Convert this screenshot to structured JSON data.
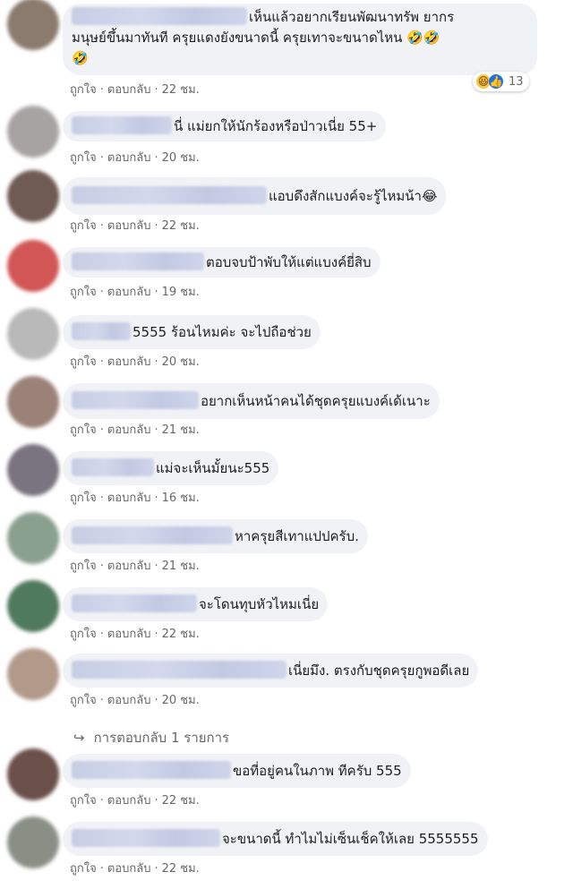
{
  "action_labels": {
    "like": "ถูกใจ",
    "reply": "ตอบกลับ"
  },
  "comments": [
    {
      "text_line1": "เห็นแล้วอยากเรียนพัฒนาทรัพ ยากร",
      "text_line2": "มนุษย์ขึ้นมาทันที ครุยแดงยังขนาดนี้ ครุยเทาจะขนาดไหน 🤣🤣",
      "text_line3": "🤣",
      "time": "22 ชม.",
      "reaction_count": "13",
      "avatar_color": "#8b7b6e"
    },
    {
      "text": "นี่ แม่ยกให้นักร้องหรือป่าวเนี่ย 55+",
      "time": "20 ชม.",
      "avatar_color": "#a7a3a3"
    },
    {
      "text": "แอบดึงสักแบงค์จะรู้ไหมน้า😂",
      "time": "22 ชม.",
      "avatar_color": "#6f5a54"
    },
    {
      "text": "ตอบจบป้าพับให้แต่แบงค์ยี่สิบ",
      "time": "19 ชม.",
      "avatar_color": "#d25656"
    },
    {
      "text": "5555 ร้อนไหมค่ะ จะไปถือช่วย",
      "time": "20 ชม.",
      "avatar_color": "#b9b9b9"
    },
    {
      "text": "อยากเห็นหน้าคนได้ชุดครุยแบงค์เด้เนาะ",
      "time": "21 ชม.",
      "avatar_color": "#9a8278"
    },
    {
      "text": "แม่จะเห็นมั้ยนะ555",
      "time": "16 ชม.",
      "avatar_color": "#7a7380"
    },
    {
      "text": "หาครุยสีเทาแปปครับ.",
      "time": "21 ชม.",
      "avatar_color": "#8aa08f"
    },
    {
      "text": "จะโดนทุบหัวไหมเนี่ย",
      "time": "22 ชม.",
      "avatar_color": "#4f7a5d"
    },
    {
      "text": "เนี่ยมึง. ตรงกับชุดครุยกูพอดีเลย",
      "time": "20 ชม.",
      "avatar_color": "#b29a8a"
    },
    {
      "text": "ขอที่อยู่คนในภาพ ทีครับ 555",
      "time": "22 ชม.",
      "avatar_color": "#6a4f4a"
    },
    {
      "text": "จะขนาดนี้ ทำไมไม่เซ็นเช็คให้เลย 5555555",
      "time": "22 ชม.",
      "avatar_color": "#8a8f86"
    }
  ],
  "replies_link": "การตอบกลับ 1 รายการ"
}
